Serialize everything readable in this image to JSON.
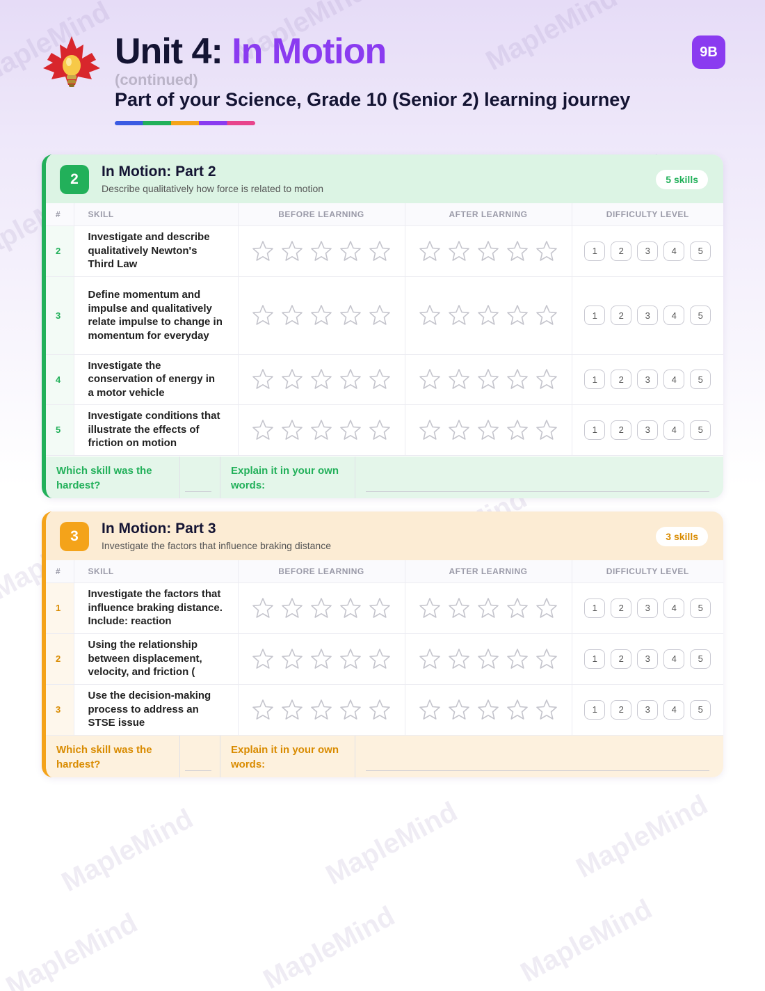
{
  "header": {
    "unit": "Unit 4:",
    "name": "In Motion",
    "continued": "(continued)",
    "subtitle": "Part of your Science, Grade 10 (Senior 2) learning journey",
    "badge": "9B"
  },
  "colors": {
    "accent": "#8a3bf0",
    "green": "#22b05a",
    "orange": "#f4a31a",
    "navy": "#141433"
  },
  "columns": {
    "num": "#",
    "skill": "SKILL",
    "before": "BEFORE LEARNING",
    "after": "AFTER LEARNING",
    "difficulty": "DIFFICULTY LEVEL"
  },
  "difficulty_levels": [
    "1",
    "2",
    "3",
    "4",
    "5"
  ],
  "sections": [
    {
      "number": "2",
      "title": "In Motion: Part 2",
      "description": "Describe qualitatively how force is related to motion",
      "skill_count": "5 skills",
      "rows": [
        {
          "num": "2",
          "skill": "Investigate and describe qualitatively Newton's Third Law"
        },
        {
          "num": "3",
          "skill": "Define momentum and impulse and qualitatively relate impulse to change in momentum for everyday"
        },
        {
          "num": "4",
          "skill": "Investigate the conservation of energy in a motor vehicle"
        },
        {
          "num": "5",
          "skill": "Investigate conditions that illustrate the effects of friction on motion"
        }
      ],
      "footer": {
        "hardest_q": "Which skill was the hardest?",
        "explain_q": "Explain it in your own words:"
      }
    },
    {
      "number": "3",
      "title": "In Motion: Part 3",
      "description": "Investigate the factors that influence braking distance",
      "skill_count": "3 skills",
      "rows": [
        {
          "num": "1",
          "skill": "Investigate the factors that influence braking distance. Include: reaction"
        },
        {
          "num": "2",
          "skill": "Using the relationship between displacement, velocity, and friction ("
        },
        {
          "num": "3",
          "skill": "Use the decision-making process to address an STSE issue"
        }
      ],
      "footer": {
        "hardest_q": "Which skill was the hardest?",
        "explain_q": "Explain it in your own words:"
      }
    }
  ],
  "watermark": "MapleMind"
}
